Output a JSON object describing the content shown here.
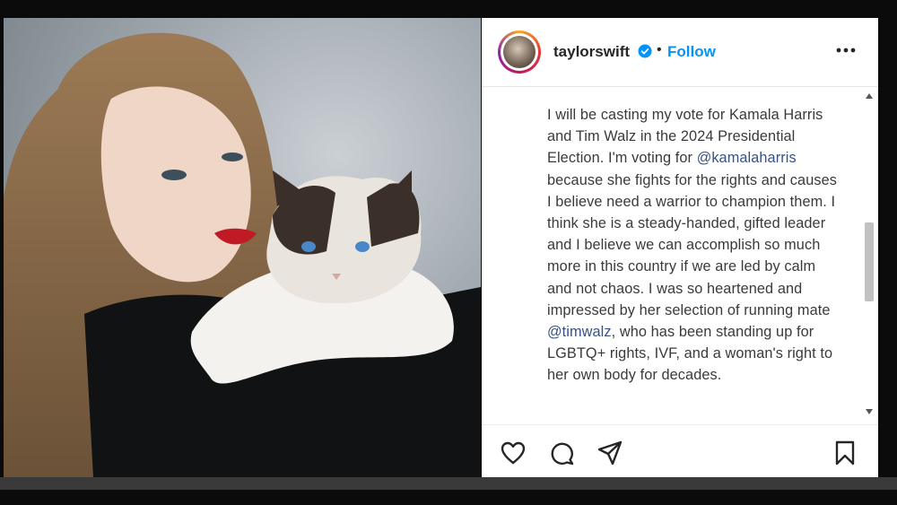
{
  "post": {
    "username": "taylorswift",
    "separator": "•",
    "follow_label": "Follow",
    "caption_parts": [
      {
        "text": "I will be casting my vote for Kamala Harris and Tim Walz in the 2024 Presidential Election. I'm voting for ",
        "type": "text"
      },
      {
        "text": "@kamalaharris",
        "type": "mention"
      },
      {
        "text": " because she fights for the rights and causes I believe need a warrior to champion them. I think she is a steady-handed, gifted leader and I believe we can accomplish so much more in this country if we are led by calm and not chaos. I was so heartened and impressed by her selection of running mate ",
        "type": "text"
      },
      {
        "text": "@timwalz",
        "type": "mention"
      },
      {
        "text": ", who has been standing up for LGBTQ+ rights, IVF, and a woman's right to her own body for decades.",
        "type": "text"
      }
    ]
  },
  "icons": {
    "verified": "verified-badge-icon",
    "more": "more-options-icon",
    "like": "heart-icon",
    "comment": "comment-icon",
    "share": "send-icon",
    "save": "bookmark-icon"
  },
  "colors": {
    "link": "#0095f6",
    "mention": "#385185",
    "text": "#262626"
  }
}
